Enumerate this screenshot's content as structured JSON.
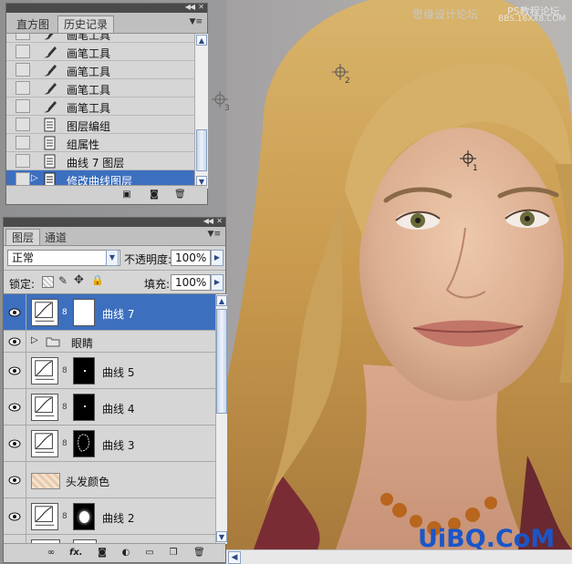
{
  "history_panel": {
    "tabs": [
      {
        "label": "直方图",
        "active": false
      },
      {
        "label": "历史记录",
        "active": true
      }
    ],
    "items": [
      {
        "label": "画笔工具",
        "icon": "brush-icon",
        "selected": false
      },
      {
        "label": "画笔工具",
        "icon": "brush-icon",
        "selected": false
      },
      {
        "label": "画笔工具",
        "icon": "brush-icon",
        "selected": false
      },
      {
        "label": "画笔工具",
        "icon": "brush-icon",
        "selected": false
      },
      {
        "label": "画笔工具",
        "icon": "brush-icon",
        "selected": false
      },
      {
        "label": "图层编组",
        "icon": "document-icon",
        "selected": false
      },
      {
        "label": "组属性",
        "icon": "document-icon",
        "selected": false
      },
      {
        "label": "曲线 7 图层",
        "icon": "document-icon",
        "selected": false
      },
      {
        "label": "修改曲线图层",
        "icon": "document-icon",
        "selected": true
      }
    ]
  },
  "layers_panel": {
    "tabs": [
      {
        "label": "图层",
        "active": true
      },
      {
        "label": "通道",
        "active": false
      }
    ],
    "blend_mode": "正常",
    "opacity_label": "不透明度:",
    "opacity": "100%",
    "lock_label": "锁定:",
    "fill_label": "填充:",
    "fill": "100%",
    "layers": [
      {
        "name": "曲线 7",
        "type": "curves",
        "mask": "white",
        "selected": true
      },
      {
        "name": "眼睛",
        "type": "group",
        "selected": false
      },
      {
        "name": "曲线 5",
        "type": "curves",
        "mask": "black-dot",
        "selected": false
      },
      {
        "name": "曲线 4",
        "type": "curves",
        "mask": "black-dot",
        "selected": false
      },
      {
        "name": "曲线 3",
        "type": "curves",
        "mask": "black-outline",
        "selected": false
      },
      {
        "name": "头发颜色",
        "type": "pixel",
        "selected": false
      },
      {
        "name": "曲线 2",
        "type": "curves",
        "mask": "black-blob",
        "selected": false
      }
    ]
  },
  "canvas": {
    "markers": [
      "1",
      "2",
      "3"
    ]
  },
  "watermarks": {
    "top": "思缘设计论坛",
    "top_right": "PS教程论坛",
    "top_right_url": "BBS.16XX8.COM",
    "bottom_right": "UiBQ.CoM"
  },
  "colors": {
    "selection": "#3d6fbf",
    "panel_bg": "#d6d6d6",
    "watermark_blue": "#1a56c8"
  }
}
